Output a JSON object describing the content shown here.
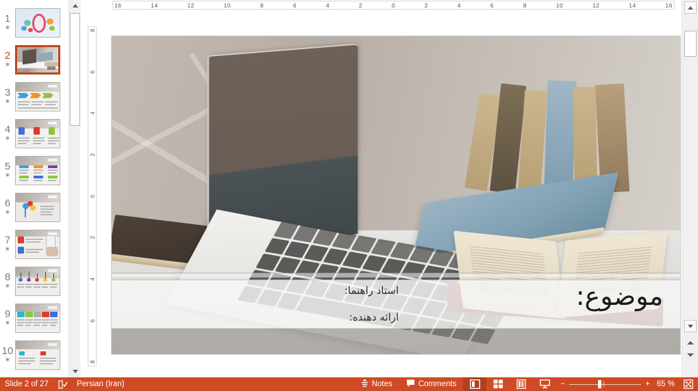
{
  "app": {
    "name": "PowerPoint",
    "view": "Normal"
  },
  "rulers": {
    "horizontal": [
      "16",
      "14",
      "12",
      "10",
      "8",
      "6",
      "4",
      "2",
      "0",
      "2",
      "4",
      "6",
      "8",
      "10",
      "12",
      "14",
      "16"
    ],
    "vertical": [
      "8",
      "6",
      "4",
      "2",
      "0",
      "2",
      "4",
      "6",
      "8"
    ]
  },
  "thumbnails": {
    "selected_index": 2,
    "items": [
      {
        "number": "1",
        "star": "✶",
        "kind": "title-ornament"
      },
      {
        "number": "2",
        "star": "✶",
        "kind": "photo-title"
      },
      {
        "number": "3",
        "star": "✶",
        "kind": "arrows-process"
      },
      {
        "number": "4",
        "star": "✶",
        "kind": "three-cards"
      },
      {
        "number": "5",
        "star": "✶",
        "kind": "six-blocks"
      },
      {
        "number": "6",
        "star": "✶",
        "kind": "person-balloons"
      },
      {
        "number": "7",
        "star": "✶",
        "kind": "phone-hand"
      },
      {
        "number": "8",
        "star": "✶",
        "kind": "pins-timeline"
      },
      {
        "number": "9",
        "star": "✶",
        "kind": "five-columns"
      },
      {
        "number": "10",
        "star": "✶",
        "kind": "two-panels"
      }
    ]
  },
  "slide": {
    "title": "موضوع:",
    "line_supervisor": "استاد راهنما:",
    "line_presenter": "ارائه دهنده:",
    "image_alt": "laptop-and-books-photo"
  },
  "status": {
    "slide_counter": "Slide 2 of 27",
    "spell_icon": "spell-check-icon",
    "language": "Persian (Iran)",
    "notes_label": "Notes",
    "notes_icon": "notes-icon",
    "comments_label": "Comments",
    "comments_icon": "comment-bubble-icon",
    "views": [
      {
        "name": "normal-view",
        "icon": "normal-view-icon",
        "active": true
      },
      {
        "name": "slide-sorter-view",
        "icon": "slide-sorter-icon",
        "active": false
      },
      {
        "name": "reading-view",
        "icon": "reading-view-icon",
        "active": false
      },
      {
        "name": "slide-show-view",
        "icon": "slide-show-icon",
        "active": false
      }
    ],
    "zoom_out": "−",
    "zoom_in": "+",
    "zoom_level": "65 %",
    "fit_icon": "fit-slide-to-window-icon",
    "bar_color": "#cf4b26",
    "active_view_color": "#b23f1f"
  },
  "scrollbars": {
    "thumb_panel_up": "▲",
    "thumb_panel_down": "▼",
    "slide_up": "▲",
    "slide_down": "▼",
    "previous_slide": "previous-slide-icon",
    "next_slide": "next-slide-icon"
  }
}
